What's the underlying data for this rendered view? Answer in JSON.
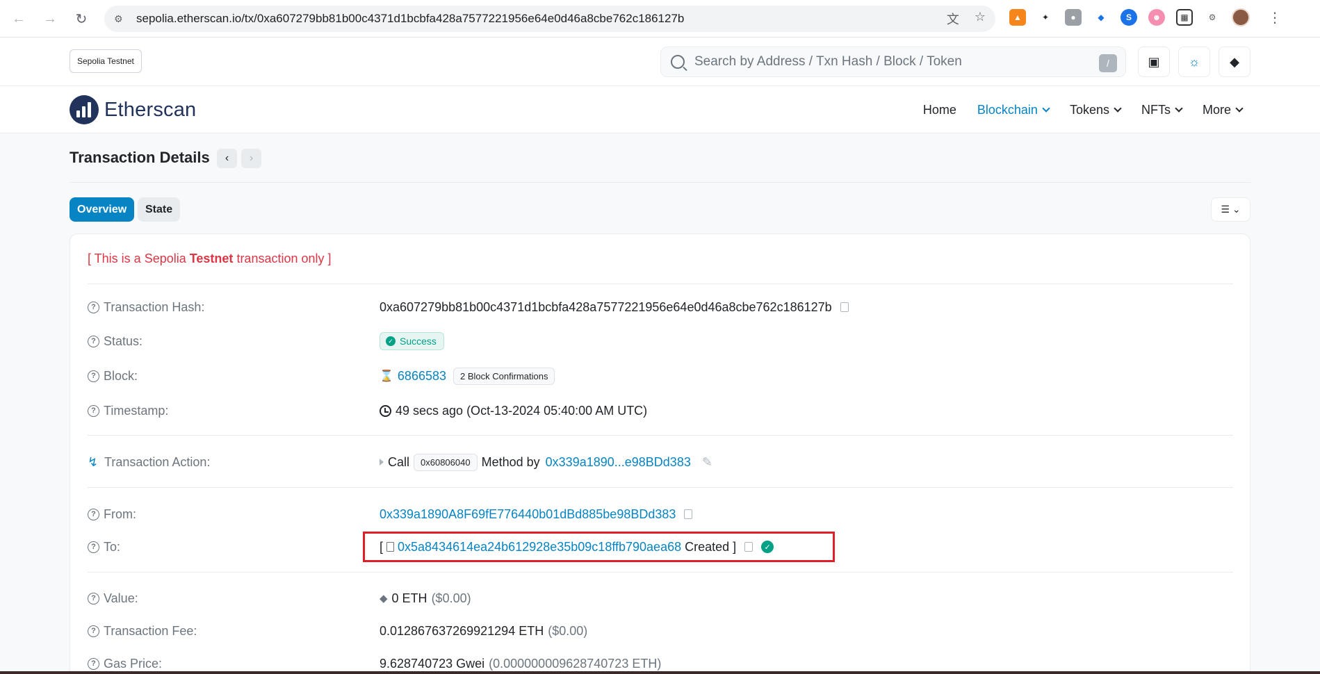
{
  "browser": {
    "url": "sepolia.etherscan.io/tx/0xa607279bb81b00c4371d1bcbfa428a7577221956e64e0d46a8cbe762c186127b"
  },
  "topbar": {
    "network_badge": "Sepolia Testnet",
    "search_placeholder": "Search by Address / Txn Hash / Block / Token",
    "search_shortcut": "/"
  },
  "header": {
    "logo_text": "Etherscan",
    "menu": [
      "Home",
      "Blockchain",
      "Tokens",
      "NFTs",
      "More"
    ],
    "active_menu": "Blockchain"
  },
  "page": {
    "title": "Transaction Details",
    "tabs": [
      "Overview",
      "State"
    ],
    "notice_prefix": "[ This is a Sepolia ",
    "notice_bold": "Testnet",
    "notice_suffix": " transaction only ]"
  },
  "details": {
    "hash_label": "Transaction Hash:",
    "hash_value": "0xa607279bb81b00c4371d1bcbfa428a7577221956e64e0d46a8cbe762c186127b",
    "status_label": "Status:",
    "status_value": "Success",
    "block_label": "Block:",
    "block_value": "6866583",
    "block_confirmations": "2 Block Confirmations",
    "timestamp_label": "Timestamp:",
    "timestamp_value": "49 secs ago (Oct-13-2024 05:40:00 AM UTC)",
    "action_label": "Transaction Action:",
    "action_call": "Call",
    "action_method": "0x60806040",
    "action_method_by": "Method by",
    "action_address": "0x339a1890...e98BDd383",
    "from_label": "From:",
    "from_value": "0x339a1890A8F69fE776440b01dBd885be98BDd383",
    "to_label": "To:",
    "to_open": "[",
    "to_value": "0x5a8434614ea24b612928e35b09c18ffb790aea68",
    "to_created": "Created ]",
    "value_label": "Value:",
    "value_amount": "0 ETH",
    "value_usd": "($0.00)",
    "fee_label": "Transaction Fee:",
    "fee_amount": "0.012867637269921294 ETH",
    "fee_usd": "($0.00)",
    "gas_label": "Gas Price:",
    "gas_amount": "9.628740723 Gwei",
    "gas_eth": "(0.000000009628740723 ETH)"
  },
  "colors": {
    "brand": "#0784c3",
    "success": "#00a186",
    "alert": "#dc3545",
    "highlight": "#e01e28"
  }
}
